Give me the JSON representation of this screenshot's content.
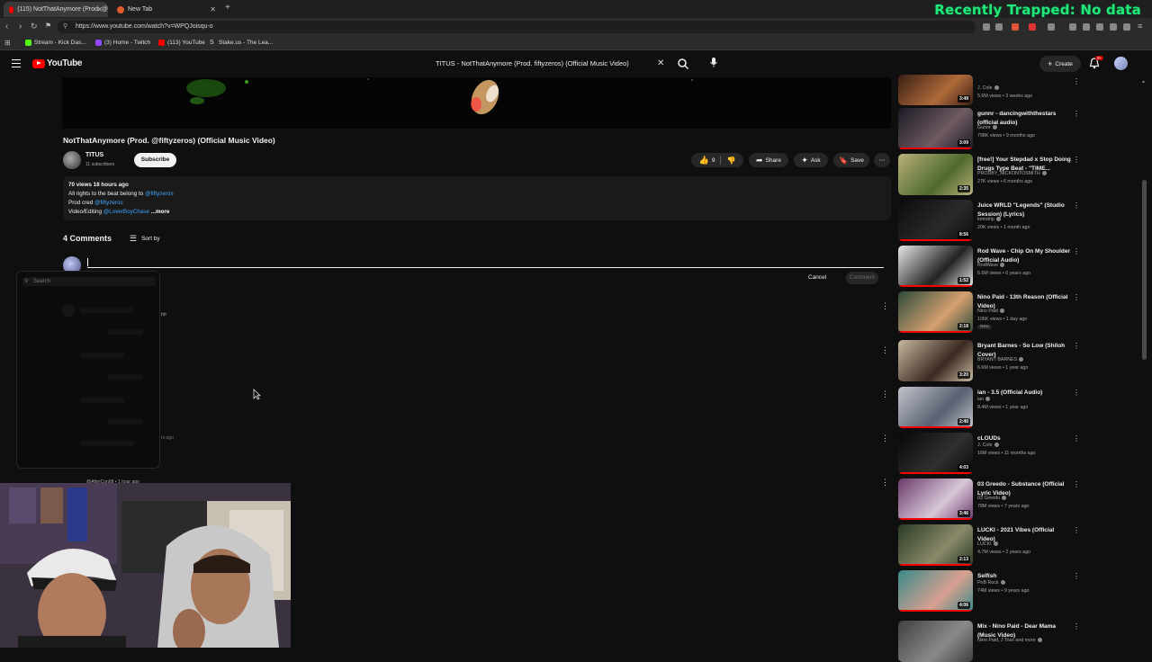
{
  "browser": {
    "tabs": [
      {
        "label": "(115) NotThatAnymore (Prod. @",
        "active": true
      },
      {
        "label": "New Tab",
        "active": false
      }
    ],
    "new_tab_icon": "plus-icon",
    "url": "https://www.youtube.com/watch?v=WPQJoisqu-o",
    "bookmarks": [
      {
        "label": "Stream - Kick Das...",
        "color": "#53fc18"
      },
      {
        "label": "(3) Home - Twitch",
        "color": "#9146ff"
      },
      {
        "label": "(113) YouTube",
        "color": "#ff0000"
      },
      {
        "label": "Stake.us - The Lea...",
        "color": "#dddddd"
      }
    ]
  },
  "overlay": {
    "text": "Recently Trapped: No data",
    "color": "#22e87a"
  },
  "youtube_header": {
    "logo_text": "YouTube",
    "search_value": "TITUS - NotThatAnymore (Prod. fiftyzeros) (Official Music Video)",
    "create_label": "Create",
    "notification_count": "9+"
  },
  "video": {
    "title": "NotThatAnymore (Prod. @fiftyzeros) (Official Music Video)",
    "channel": "TITUS",
    "subscribers": "11 subscribers",
    "subscribe_label": "Subscribe",
    "likes": "9",
    "share_label": "Share",
    "ask_label": "Ask",
    "save_label": "Save"
  },
  "description": {
    "meta": "70 views  18 hours ago",
    "line1_text": "All rights to the beat belong to ",
    "line1_link": "@fiftyzeros",
    "line2_text": "Prod cred ",
    "line2_link": "@fiftyzeros",
    "line3_text": "Video/Editing ",
    "line3_link": "@LoverBoyChase",
    "more": "...more"
  },
  "comments": {
    "count_label": "4 Comments",
    "sort_label": "Sort by",
    "cancel_label": "Cancel",
    "comment_label": "Comment",
    "peek_text": "hit",
    "ago_text": "rs ago",
    "partial_handle": "@AfterCon98 • 1 hour ago"
  },
  "emoji_picker": {
    "search_placeholder": "Search"
  },
  "sidebar": [
    {
      "title": "",
      "channel": "J. Cole",
      "meta": "5.6M views • 3 weeks ago",
      "duration": "3:49",
      "colors": [
        "#3a1f14",
        "#b06a3a"
      ],
      "progress": 0
    },
    {
      "title": "gunnr - dancingwiththestars (official audio)",
      "channel": "Gunnr",
      "meta": "798K views • 9 months ago",
      "duration": "3:09",
      "colors": [
        "#1c1a24",
        "#6e5a62"
      ],
      "progress": 1
    },
    {
      "title": "[free!] Your Stepdad x Stop Doing Drugs Type Beat - \"TIME...",
      "channel": "PRODBY_NICKONTOSMITH",
      "meta": "27K views • 6 months ago",
      "duration": "2:35",
      "colors": [
        "#b8b07a",
        "#4f6a2c"
      ],
      "progress": 0
    },
    {
      "title": "Juice WRLD \"Legends\" (Studio Session) (Lyrics)",
      "channel": "kmndrip",
      "meta": "20K views • 1 month ago",
      "duration": "8:56",
      "colors": [
        "#0c0c0c",
        "#2a2a2a"
      ],
      "progress": 1
    },
    {
      "title": "Rod Wave - Chip On My Shoulder (Official Audio)",
      "channel": "RodWave",
      "meta": "6.5M views • 6 years ago",
      "duration": "1:52",
      "colors": [
        "#e8e8e8",
        "#222222"
      ],
      "progress": 1
    },
    {
      "title": "Nino Paid - 13th Reason (Official Video)",
      "channel": "Nino Paid",
      "meta": "106K views • 1 day ago",
      "duration": "2:18",
      "colors": [
        "#2d4a3a",
        "#d4a070"
      ],
      "progress": 1,
      "badge": "New"
    },
    {
      "title": "Bryant Barnes - So Low (Shiloh Cover)",
      "channel": "BRYANT BARNES",
      "meta": "6.6M views • 1 year ago",
      "duration": "3:20",
      "colors": [
        "#c8b8a0",
        "#3a2a20"
      ],
      "progress": 0
    },
    {
      "title": "ian - 3.5 (Official Audio)",
      "channel": "ian",
      "meta": "8.4M views • 1 year ago",
      "duration": "2:40",
      "colors": [
        "#c0c4cc",
        "#5a6070"
      ],
      "progress": 1
    },
    {
      "title": "cLOUDs",
      "channel": "J. Cole",
      "meta": "16M views • 11 months ago",
      "duration": "4:03",
      "colors": [
        "#080808",
        "#303030"
      ],
      "progress": 1
    },
    {
      "title": "03 Greedo - Substance (Official Lyric Video)",
      "channel": "03 Greedo",
      "meta": "78M views • 7 years ago",
      "duration": "3:46",
      "colors": [
        "#6a3a6a",
        "#d8c8d8"
      ],
      "progress": 1
    },
    {
      "title": "LUCKI - 2021 Vibes (Official Video)",
      "channel": "LUCKI",
      "meta": "4.7M views • 2 years ago",
      "duration": "2:13",
      "colors": [
        "#2a3a24",
        "#8a8a6a"
      ],
      "progress": 1
    },
    {
      "title": "Selfish",
      "channel": "PnB Rock",
      "meta": "74M views • 9 years ago",
      "duration": "4:06",
      "colors": [
        "#3a8a8a",
        "#d8a090"
      ],
      "progress": 1
    },
    {
      "title": "Mix - Nino Paid - Dear Mama (Music Video)",
      "channel": "Nino Paid, J Toss and more",
      "meta": "",
      "duration": "",
      "colors": [
        "#404040",
        "#8a8a8a"
      ],
      "progress": 0
    }
  ]
}
